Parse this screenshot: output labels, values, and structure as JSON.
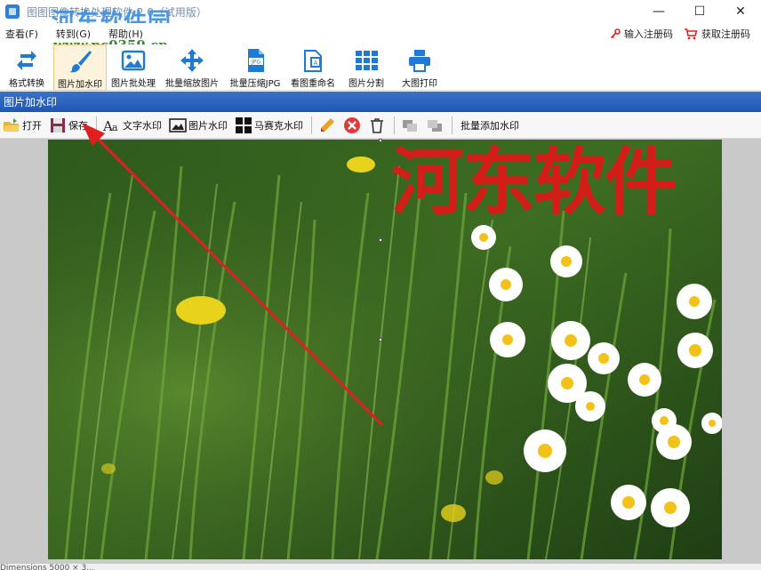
{
  "window": {
    "title": "图图图像转换处理软件 2.0（试用版）",
    "site_watermark_name": "河东软件园",
    "site_watermark_url": "www.pc0359.cn",
    "minimize": "—",
    "maximize": "☐",
    "close": "✕"
  },
  "menu": {
    "items": [
      "查看(F)",
      "转到(G)",
      "帮助(H)"
    ],
    "register_code": "输入注册码",
    "get_register_code": "获取注册码"
  },
  "toolbar": {
    "items": [
      {
        "label": "格式转换",
        "icon": "convert-icon"
      },
      {
        "label": "图片加水印",
        "icon": "brush-icon",
        "active": true
      },
      {
        "label": "图片批处理",
        "icon": "picture-icon"
      },
      {
        "label": "批量缩放图片",
        "icon": "move-arrows-icon"
      },
      {
        "label": "批量压缩JPG",
        "icon": "jpg-file-icon"
      },
      {
        "label": "看图重命名",
        "icon": "rename-icon"
      },
      {
        "label": "图片分割",
        "icon": "grid-icon"
      },
      {
        "label": "大图打印",
        "icon": "printer-icon"
      }
    ]
  },
  "section": {
    "title": "图片加水印"
  },
  "subtoolbar": {
    "open": "打开",
    "save": "保存",
    "text_watermark": "文字水印",
    "image_watermark": "图片水印",
    "mosaic_watermark": "马赛克水印",
    "batch_watermark": "批量添加水印"
  },
  "canvas": {
    "watermark_text": "河东软件",
    "watermark_color": "#e01818"
  },
  "status": {
    "text": "Dimensions 5000 × 3..."
  }
}
